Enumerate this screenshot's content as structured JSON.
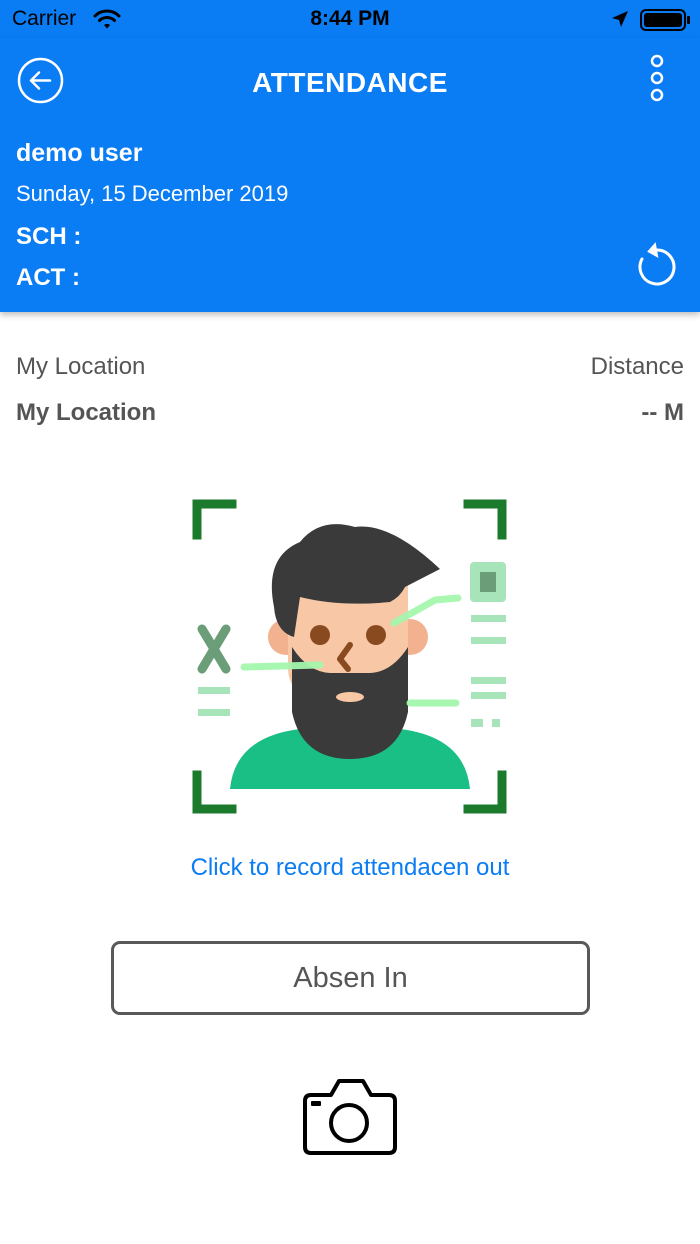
{
  "status_bar": {
    "carrier": "Carrier",
    "time": "8:44 PM"
  },
  "header": {
    "title": "ATTENDANCE",
    "user_name": "demo user",
    "date": "Sunday, 15 December 2019",
    "sch_label": "SCH :",
    "act_label": "ACT :"
  },
  "location": {
    "label": "My Location",
    "value": "My Location",
    "distance_label": "Distance",
    "distance_value": "-- M"
  },
  "record_link": "Click to record attendacen out",
  "absen_button": "Absen In",
  "icons": {
    "back": "back-arrow-icon",
    "more": "more-vertical-icon",
    "refresh": "refresh-icon",
    "camera": "camera-icon",
    "wifi": "wifi-icon",
    "location": "location-arrow-icon",
    "battery": "battery-icon"
  },
  "colors": {
    "primary": "#0a7cf4",
    "text_gray": "#555555",
    "frame_green": "#1b7a2c",
    "shirt_green": "#1abf86"
  }
}
